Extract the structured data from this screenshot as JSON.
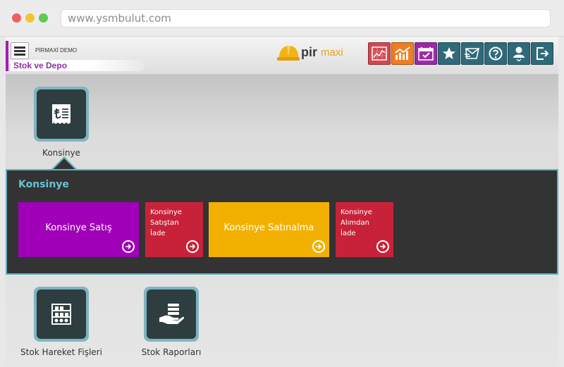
{
  "browser": {
    "url": "www.ysmbulut.com"
  },
  "header": {
    "company": "PİRMAXİ DEMO",
    "module": "Stok ve Depo",
    "logo_primary": "pir",
    "logo_secondary": "maxi"
  },
  "toolbar": [
    {
      "icon": "report-chart-icon",
      "color": "#d64650"
    },
    {
      "icon": "trend-chart-icon",
      "color": "#f07d22"
    },
    {
      "icon": "calendar-check-icon",
      "color": "#9c2aa8"
    },
    {
      "icon": "star-icon",
      "color": "#2f6a7a"
    },
    {
      "icon": "message-icon",
      "color": "#2f6a7a"
    },
    {
      "icon": "help-icon",
      "color": "#2f6a7a"
    },
    {
      "icon": "user-icon",
      "color": "#2f6a7a"
    },
    {
      "icon": "logout-icon",
      "color": "#2f6a7a"
    }
  ],
  "modules": {
    "konsinye": {
      "label": "Konsinye",
      "icon": "receipt-icon"
    },
    "stok_hareket": {
      "label": "Stok Hareket Fişleri",
      "icon": "warehouse-icon"
    },
    "stok_raporlari": {
      "label": "Stok Raporları",
      "icon": "cash-hand-icon"
    }
  },
  "panel": {
    "title": "Konsinye",
    "tiles": [
      {
        "label": "Konsinye Satış",
        "color": "#a000b8"
      },
      {
        "label": "Konsinye Satıştan İade",
        "lines": [
          "Konsinye",
          "Satıştan",
          "İade"
        ],
        "color": "#c8223a"
      },
      {
        "label": "Konsinye Satınalma",
        "color": "#f2b101"
      },
      {
        "label": "Konsinye Alımdan İade",
        "lines": [
          "Konsinye",
          "Alımdan",
          "İade"
        ],
        "color": "#c8223a"
      }
    ]
  },
  "colors": {
    "accent": "#5fb2c2",
    "tile_dark": "#2e3d40"
  }
}
